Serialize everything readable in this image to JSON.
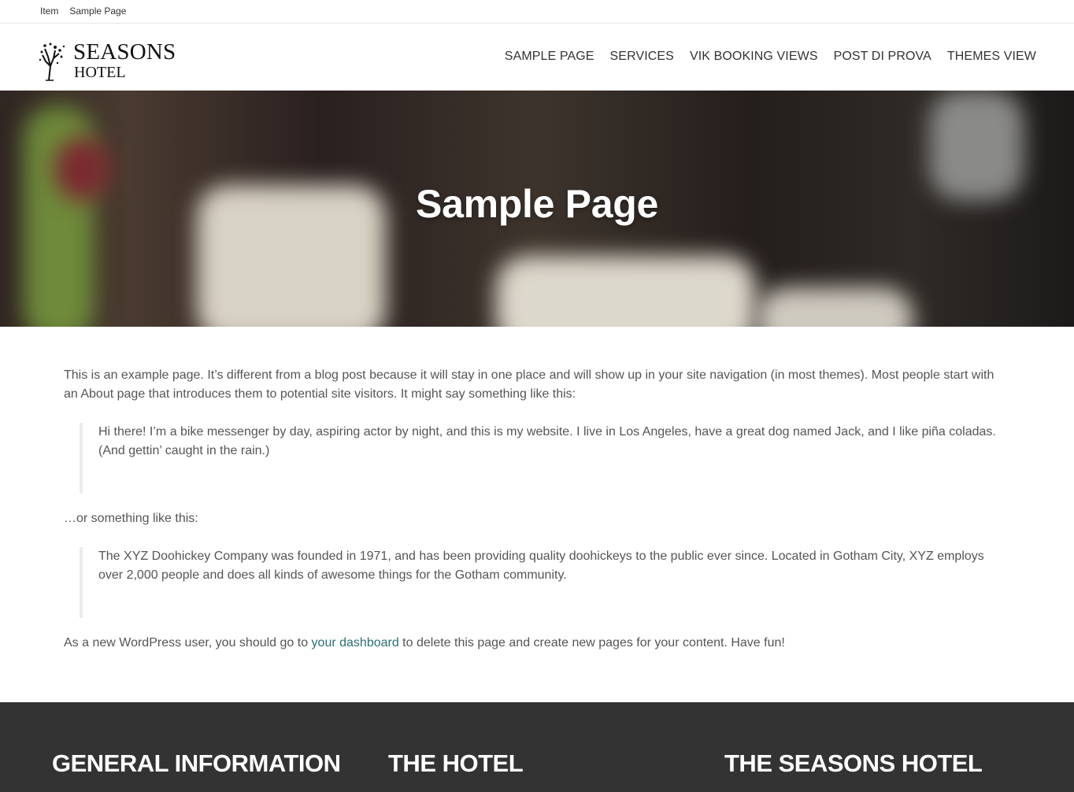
{
  "breadcrumb": {
    "item": "Item",
    "current": "Sample Page"
  },
  "logo": {
    "line1": "SEASONS",
    "line2": "HOTEL"
  },
  "nav": [
    "SAMPLE PAGE",
    "SERVICES",
    "VIK BOOKING VIEWS",
    "POST DI PROVA",
    "THEMES VIEW"
  ],
  "hero": {
    "title": "Sample Page"
  },
  "content": {
    "intro": "This is an example page. It’s different from a blog post because it will stay in one place and will show up in your site navigation (in most themes). Most people start with an About page that introduces them to potential site visitors. It might say something like this:",
    "quote1": "Hi there! I’m a bike messenger by day, aspiring actor by night, and this is my website. I live in Los Angeles, have a great dog named Jack, and I like piña coladas. (And gettin’ caught in the rain.)",
    "middle": "…or something like this:",
    "quote2": "The XYZ Doohickey Company was founded in 1971, and has been providing quality doohickeys to the public ever since. Located in Gotham City, XYZ employs over 2,000 people and does all kinds of awesome things for the Gotham community.",
    "outro_before": "As a new WordPress user, you should go to ",
    "outro_link": "your dashboard",
    "outro_after": " to delete this page and create new pages for your content. Have fun!"
  },
  "footer": {
    "col1": "GENERAL INFORMATION",
    "col2": "THE HOTEL",
    "col3": "THE SEASONS HOTEL"
  },
  "colors": {
    "link": "#2a6f73",
    "footer_bg": "#333333",
    "text": "#555555"
  }
}
